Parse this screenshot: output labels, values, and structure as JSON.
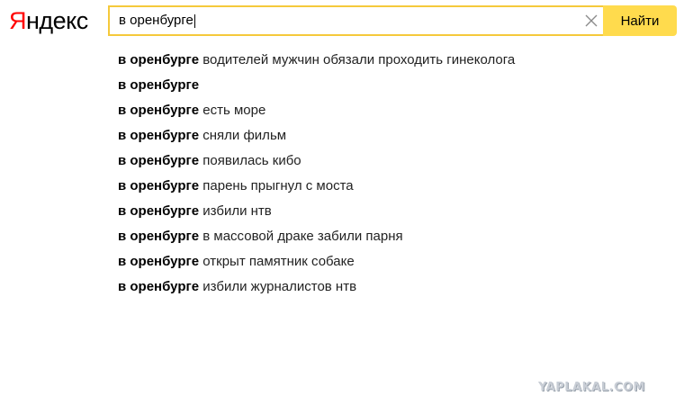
{
  "logo": {
    "first_letter": "Я",
    "rest": "ндекс"
  },
  "search": {
    "query": "в оренбурге",
    "button_label": "Найти",
    "accent_color": "#ffdb4d",
    "clear_icon": "close-icon"
  },
  "suggestions": [
    {
      "bold": "в оренбурге",
      "rest": " водителей мужчин обязали проходить гинеколога"
    },
    {
      "bold": "в оренбурге",
      "rest": ""
    },
    {
      "bold": "в оренбурге",
      "rest": " есть море"
    },
    {
      "bold": "в оренбурге",
      "rest": " сняли фильм"
    },
    {
      "bold": "в оренбурге",
      "rest": " появилась кибо"
    },
    {
      "bold": "в оренбурге",
      "rest": " парень прыгнул с моста"
    },
    {
      "bold": "в оренбурге",
      "rest": " избили нтв"
    },
    {
      "bold": "в оренбурге",
      "rest": " в массовой драке забили парня"
    },
    {
      "bold": "в оренбурге",
      "rest": " открыт памятник собаке"
    },
    {
      "bold": "в оренбурге",
      "rest": " избили журналистов нтв"
    }
  ],
  "watermark": "YAPLAKAL.COM"
}
